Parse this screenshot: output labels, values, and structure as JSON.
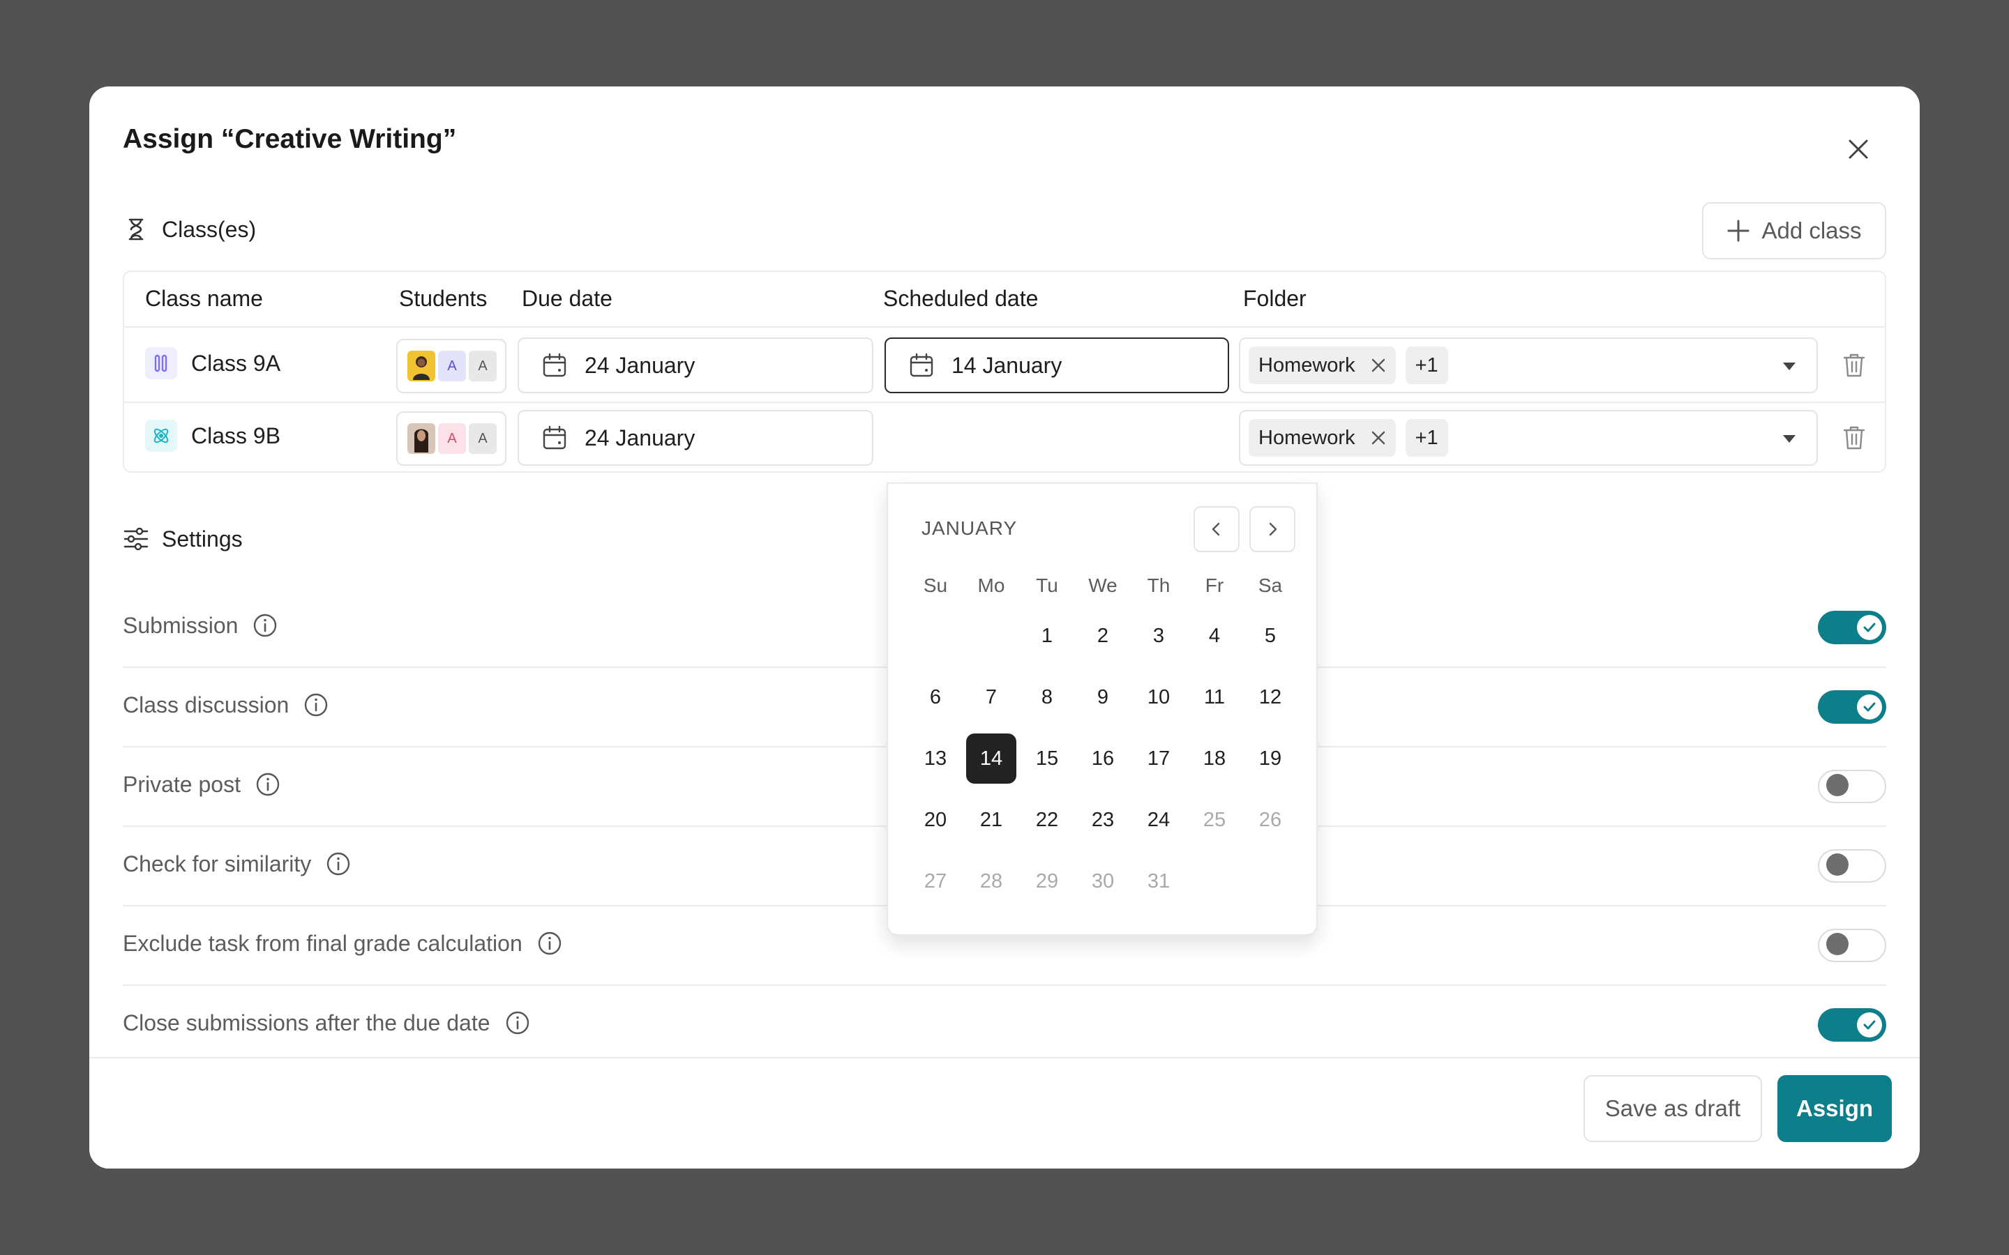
{
  "modal": {
    "title": "Assign “Creative Writing”"
  },
  "classes_section": {
    "title": "Class(es)",
    "add_label": "Add class",
    "columns": [
      "Class name",
      "Students",
      "Due date",
      "Scheduled date",
      "Folder"
    ],
    "rows": [
      {
        "name": "Class 9A",
        "icon": "test-tubes-icon",
        "icon_color": "#7c6ef0",
        "avatar_letters": [
          "A",
          "A"
        ],
        "due_date": "24 January",
        "scheduled_date": "14 January",
        "folder_chip": "Homework",
        "folder_more": "+1"
      },
      {
        "name": "Class 9B",
        "icon": "atom-icon",
        "icon_color": "#19b5c6",
        "avatar_letters": [
          "A",
          "A"
        ],
        "due_date": "24 January",
        "scheduled_date": "",
        "folder_chip": "Homework",
        "folder_more": "+1"
      }
    ]
  },
  "settings_section": {
    "title": "Settings",
    "items": [
      {
        "label": "Submission",
        "on": true
      },
      {
        "label": "Class discussion",
        "on": true
      },
      {
        "label": "Private post",
        "on": false
      },
      {
        "label": "Check for similarity",
        "on": false
      },
      {
        "label": "Exclude task from final grade calculation",
        "on": false
      },
      {
        "label": "Close submissions after the due date",
        "on": true
      }
    ]
  },
  "calendar": {
    "month": "JANUARY",
    "weekdays": [
      "Su",
      "Mo",
      "Tu",
      "We",
      "Th",
      "Fr",
      "Sa"
    ],
    "leading_blanks": 2,
    "days": [
      "1",
      "2",
      "3",
      "4",
      "5",
      "6",
      "7",
      "8",
      "9",
      "10",
      "11",
      "12",
      "13",
      "14",
      "15",
      "16",
      "17",
      "18",
      "19",
      "20",
      "21",
      "22",
      "23",
      "24",
      "25",
      "26",
      "27",
      "28",
      "29",
      "30",
      "31"
    ],
    "selected_day": "14",
    "muted_from": "25"
  },
  "footer": {
    "draft_label": "Save as draft",
    "assign_label": "Assign"
  },
  "colors": {
    "accent": "#0d7f8b",
    "backdrop": "#525252"
  }
}
